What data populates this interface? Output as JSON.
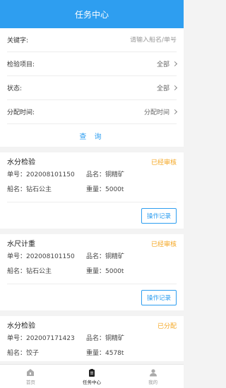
{
  "header": {
    "title": "任务中心"
  },
  "filter": {
    "keyword_label": "关键字:",
    "keyword_placeholder": "请输入船名/单号",
    "item_label": "检验项目:",
    "item_value": "全部",
    "status_label": "状态:",
    "status_value": "全部",
    "time_label": "分配时间:",
    "time_value": "分配时间",
    "query_label": "查 询"
  },
  "cards": [
    {
      "title": "水分检验",
      "status": "已经审核",
      "order_no": "单号：202008101150",
      "product": "品名：铜精矿",
      "ship": "船名：钻石公主",
      "weight": "重量：5000t",
      "action": "操作记录"
    },
    {
      "title": "水尺计重",
      "status": "已经审核",
      "order_no": "单号：202008101150",
      "product": "品名：铜精矿",
      "ship": "船名：钻石公主",
      "weight": "重量：5000t",
      "action": "操作记录"
    },
    {
      "title": "水分检验",
      "status": "已分配",
      "order_no": "单号：202007171423",
      "product": "品名：铜精矿",
      "ship": "船名：饺子",
      "weight": "重量：4578t"
    }
  ],
  "tabbar": {
    "home": "首页",
    "tasks": "任务中心",
    "mine": "我的"
  },
  "colors": {
    "primary": "#2e9ef0",
    "status": "#f4a620"
  }
}
